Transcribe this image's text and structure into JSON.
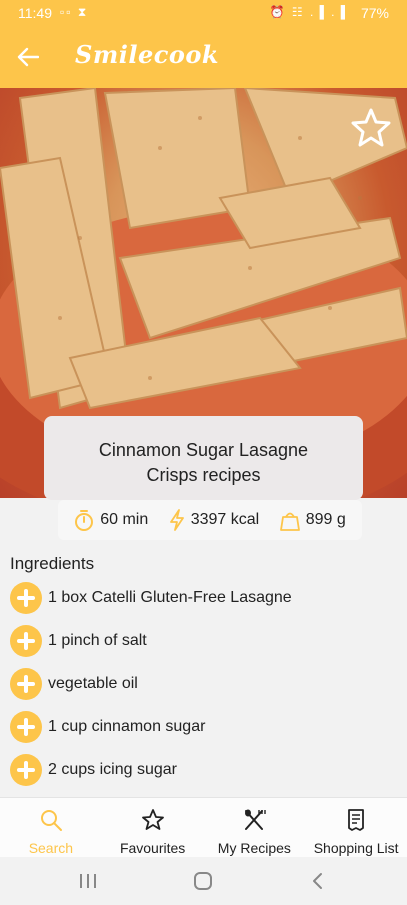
{
  "status_bar": {
    "time": "11:49",
    "left_icons": "▫▫ ⧗",
    "right_icons": "⏰ ☷ .▐ .▐",
    "battery": "77%"
  },
  "app_bar": {
    "title": "Smilecook",
    "back_icon": "arrow-left-icon"
  },
  "hero": {
    "favourite_icon": "star-outline-icon"
  },
  "recipe": {
    "title": "Cinnamon Sugar Lasagne Crisps recipes",
    "time": "60 min",
    "energy": "3397 kcal",
    "weight": "899 g"
  },
  "ingredients": {
    "heading": "Ingredients",
    "items": [
      "1 box Catelli Gluten-Free Lasagne",
      "1 pinch of salt",
      "vegetable oil",
      "1 cup cinnamon sugar",
      "2 cups icing sugar"
    ]
  },
  "bottom_nav": {
    "items": [
      {
        "label": "Search",
        "icon": "search-icon",
        "active": true
      },
      {
        "label": "Favourites",
        "icon": "star-icon",
        "active": false
      },
      {
        "label": "My Recipes",
        "icon": "fork-spoon-icon",
        "active": false
      },
      {
        "label": "Shopping List",
        "icon": "receipt-icon",
        "active": false
      }
    ]
  },
  "colors": {
    "accent": "#fdc54a",
    "background": "#f2f2f2",
    "text": "#222222"
  }
}
